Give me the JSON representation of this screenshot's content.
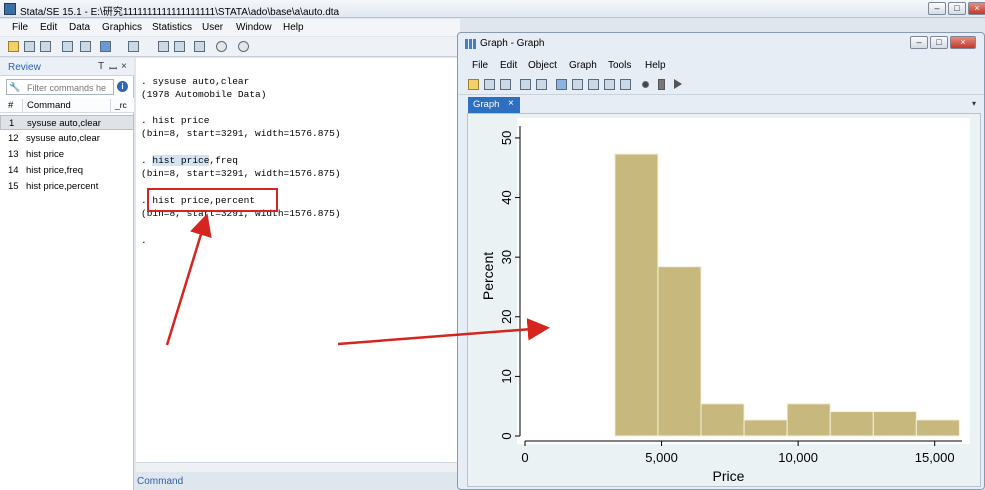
{
  "main_window": {
    "title": "Stata/SE 15.1 - E:\\研究1111111111111111111\\STATA\\ado\\base\\a\\auto.dta",
    "menu": [
      "File",
      "Edit",
      "Data",
      "Graphics",
      "Statistics",
      "User",
      "Window",
      "Help"
    ]
  },
  "review": {
    "title": "Review",
    "filter_placeholder": "Filter commands he",
    "col_num": "#",
    "col_command": "Command",
    "col_rc": "_rc",
    "rows": [
      {
        "num": "1",
        "cmd": "sysuse auto,clear"
      },
      {
        "num": "12",
        "cmd": "sysuse auto,clear"
      },
      {
        "num": "13",
        "cmd": "hist price"
      },
      {
        "num": "14",
        "cmd": "hist price,freq"
      },
      {
        "num": "15",
        "cmd": "hist price,percent"
      }
    ]
  },
  "results": {
    "lines": [
      ". sysuse auto,clear",
      "(1978 Automobile Data)",
      ". hist price",
      "(bin=8, start=3291, width=1576.875)",
      ". hist price,freq",
      "(bin=8, start=3291, width=1576.875)",
      ". hist price,percent",
      "(bin=8, start=3291, width=1576.875)",
      "."
    ],
    "command_label": "Command"
  },
  "graph_window": {
    "title": "Graph - Graph",
    "menu": [
      "File",
      "Edit",
      "Object",
      "Graph",
      "Tools",
      "Help"
    ],
    "tab_label": "Graph",
    "tab_close": "×"
  },
  "chart_data": {
    "type": "bar",
    "xlabel": "Price",
    "ylabel": "Percent",
    "xlim": [
      0,
      16000
    ],
    "ylim": [
      0,
      52
    ],
    "xticks": [
      0,
      5000,
      10000,
      15000
    ],
    "xtick_labels": [
      "0",
      "5,000",
      "10,000",
      "15,000"
    ],
    "yticks": [
      0,
      10,
      20,
      30,
      40,
      50
    ],
    "ytick_labels": [
      "0",
      "10",
      "20",
      "30",
      "40",
      "50"
    ],
    "bin_start": 3291,
    "bin_width": 1576.875,
    "values": [
      47.3,
      28.4,
      5.4,
      2.7,
      5.4,
      4.1,
      4.1,
      2.7
    ],
    "bar_color": "#c7b97e",
    "bar_edge": "#f5f0dc",
    "background": "#ffffff",
    "grid": false
  },
  "colors": {
    "accent": "#2a62b0",
    "annotation": "#d5251f",
    "tab": "#2d6fc1"
  }
}
